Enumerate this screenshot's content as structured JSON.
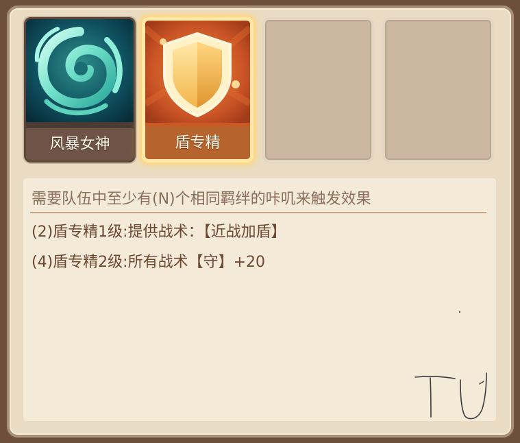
{
  "team_slots": [
    {
      "label": "风暴女神",
      "icon": "storm-swirl-icon",
      "state": "hero"
    },
    {
      "label": "盾专精",
      "icon": "shield-icon",
      "state": "selected"
    },
    {
      "label": "",
      "icon": "",
      "state": "empty"
    },
    {
      "label": "",
      "icon": "",
      "state": "empty"
    }
  ],
  "description": {
    "header": "需要队伍中至少有(N)个相同羁绊的咔叽来触发效果",
    "lines": [
      "(2)盾专精1级:提供战术：【近战加盾】",
      "(4)盾专精2级:所有战术【守】+20"
    ]
  },
  "colors": {
    "panel_bg": "#eadcc4",
    "text_header": "#8b6e5c",
    "text_body": "#6e4934",
    "selected_glow": "#ffd887"
  }
}
